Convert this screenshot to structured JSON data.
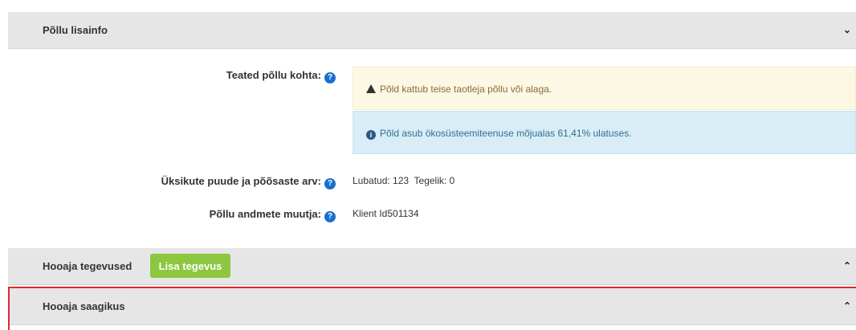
{
  "panels": {
    "lisainfo": {
      "title": "Põllu lisainfo",
      "chevron": "chevron-down-icon"
    },
    "tegevused": {
      "title": "Hooaja tegevused",
      "add_button": "Lisa tegevus",
      "chevron": "chevron-up-icon"
    },
    "saagikus": {
      "title": "Hooaja saagikus",
      "chevron": "chevron-up-icon"
    }
  },
  "details": {
    "teated_label": "Teated põllu kohta:",
    "warning_text": "Põld kattub teise taotleja põllu või alaga.",
    "info_text": "Põld asub ökosüsteemiteenuse mõjualas 61,41% ulatuses.",
    "puude_label": "Üksikute puude ja põõsaste arv:",
    "puude_value": "Lubatud: 123  Tegelik: 0",
    "muutja_label": "Põllu andmete muutja:",
    "muutja_value": "Klient Id501134"
  },
  "colors": {
    "warning_bg": "#fcf8e3",
    "info_bg": "#d9edf7",
    "button_green": "#8dc63f",
    "highlight_red": "#e1272f",
    "help_blue": "#1a6fce"
  }
}
